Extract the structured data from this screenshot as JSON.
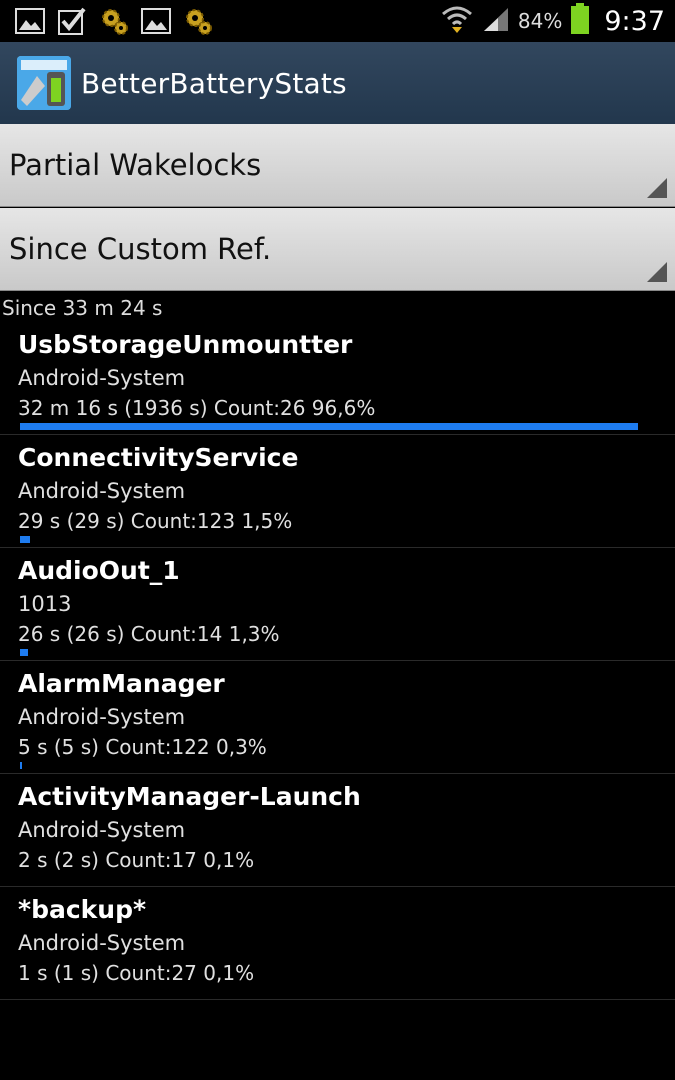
{
  "status_bar": {
    "battery_percent": "84%",
    "time": "9:37",
    "icons": [
      "image-icon",
      "checkbox-icon",
      "gear-icon",
      "image-icon",
      "gear-icon"
    ]
  },
  "app": {
    "title": "BetterBatteryStats"
  },
  "spinners": {
    "stat_type": "Partial Wakelocks",
    "reference": "Since Custom Ref."
  },
  "since_text": "Since 33 m 24 s",
  "accent_color": "#1e7cf0",
  "wakelocks": [
    {
      "name": "UsbStorageUnmountter",
      "owner": "Android-System",
      "stats": "32 m 16 s  (1936 s) Count:26 96,6%",
      "percent": 96.6
    },
    {
      "name": "ConnectivityService",
      "owner": "Android-System",
      "stats": "29 s  (29 s) Count:123 1,5%",
      "percent": 1.5
    },
    {
      "name": "AudioOut_1",
      "owner": "1013",
      "stats": "26 s  (26 s) Count:14 1,3%",
      "percent": 1.3
    },
    {
      "name": "AlarmManager",
      "owner": "Android-System",
      "stats": "5 s  (5 s) Count:122 0,3%",
      "percent": 0.3
    },
    {
      "name": "ActivityManager-Launch",
      "owner": "Android-System",
      "stats": "2 s  (2 s) Count:17 0,1%",
      "percent": 0.1
    },
    {
      "name": "*backup*",
      "owner": "Android-System",
      "stats": "1 s  (1 s) Count:27 0,1%",
      "percent": 0.1
    }
  ]
}
